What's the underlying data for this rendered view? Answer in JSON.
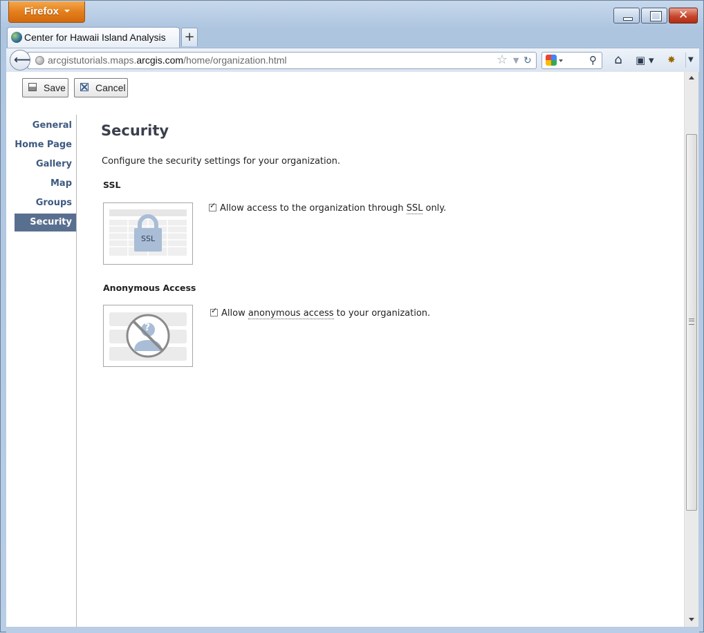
{
  "browser": {
    "app_button_label": "Firefox",
    "tab_title": "Center for Hawaii Island Analysis",
    "new_tab_symbol": "+",
    "url_prefix": "arcgistutorials.maps.",
    "url_domain": "arcgis.com",
    "url_path": "/home/organization.html",
    "icons": [
      "back-arrow-icon",
      "site-identity-icon",
      "bookmark-star-icon",
      "reload-icon",
      "google-search-icon",
      "search-magnifier-icon",
      "home-icon",
      "bookmarks-menu-icon",
      "extension-icon",
      "minimize-icon",
      "maximize-icon",
      "close-icon"
    ]
  },
  "toolbar": {
    "save_label": "Save",
    "cancel_label": "Cancel"
  },
  "sidebar": {
    "items": [
      {
        "label": "General",
        "active": false
      },
      {
        "label": "Home Page",
        "active": false
      },
      {
        "label": "Gallery",
        "active": false
      },
      {
        "label": "Map",
        "active": false
      },
      {
        "label": "Groups",
        "active": false
      },
      {
        "label": "Security",
        "active": true
      }
    ]
  },
  "main": {
    "title": "Security",
    "intro": "Configure the security settings for your organization.",
    "ssl": {
      "title": "SSL",
      "thumb_label": "SSL",
      "checked": true,
      "text_before": "Allow access to the organization through ",
      "text_link": "SSL",
      "text_after": " only."
    },
    "anonymous": {
      "title": "Anonymous Access",
      "thumb_label": "?",
      "checked": true,
      "text_before": "Allow ",
      "text_link": "anonymous access",
      "text_after": " to your organization."
    }
  },
  "colors": {
    "sidebar_active_bg": "#596f8f",
    "sidebar_link": "#3e5a80",
    "firefox_orange": "#e47f1c",
    "window_frame": "#b9cde5"
  }
}
